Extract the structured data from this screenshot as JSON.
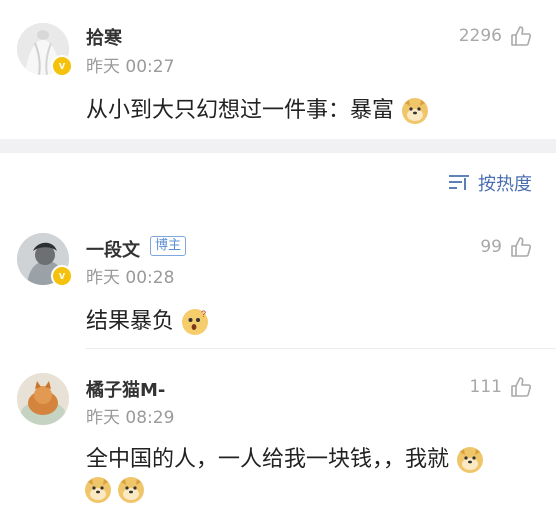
{
  "comments": [
    {
      "name": "拾寒",
      "time": "昨天 00:27",
      "text": "从小到大只幻想过一件事：暴富",
      "likes": "2296",
      "avatar_icon": "person-photo-avatar",
      "verified": true
    },
    {
      "name": "一段文",
      "badge": "博主",
      "time": "昨天 00:28",
      "text": "结果暴负",
      "likes": "99",
      "avatar_icon": "person-photo-avatar",
      "verified": true
    },
    {
      "name": "橘子猫M-",
      "time": "昨天 08:29",
      "text": "全中国的人，一人给我一块钱，，我就",
      "likes": "111",
      "avatar_icon": "cat-photo-avatar",
      "verified": false
    }
  ],
  "sort": {
    "label": "按热度",
    "icon": "sort-icon"
  },
  "colors": {
    "accent": "#4a6fb0",
    "verified": "#f4c20d",
    "doge": "#f0c66b"
  }
}
